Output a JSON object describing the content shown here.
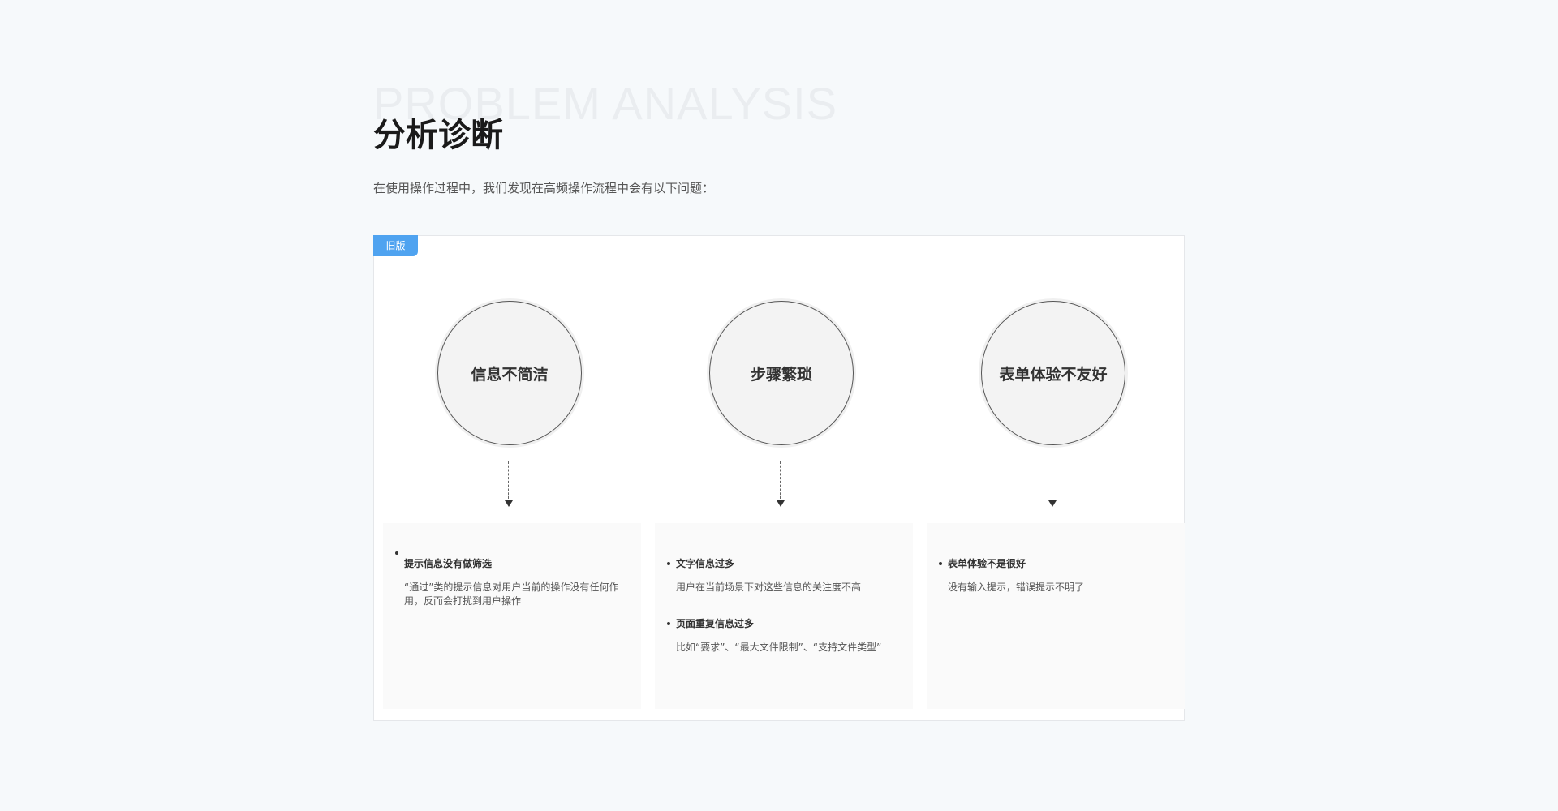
{
  "header": {
    "bg_title": "PROBLEM ANALYSIS",
    "title": "分析诊断",
    "subtitle": "在使用操作过程中，我们发现在高频操作流程中会有以下问题："
  },
  "panel": {
    "badge": "旧版",
    "badge_color": "#4fa3f0",
    "columns": [
      {
        "circle_label": "信息不简洁",
        "items": [
          {
            "title": "提示信息没有做筛选",
            "desc": "“通过”类的提示信息对用户当前的操作没有任何作用，反而会打扰到用户操作"
          }
        ]
      },
      {
        "circle_label": "步骤繁琐",
        "items": [
          {
            "title": "文字信息过多",
            "desc": "用户在当前场景下对这些信息的关注度不高"
          },
          {
            "title": "页面重复信息过多",
            "desc": "比如“要求”、“最大文件限制”、“支持文件类型”"
          }
        ]
      },
      {
        "circle_label": "表单体验不友好",
        "items": [
          {
            "title": "表单体验不是很好",
            "desc": "没有输入提示，错误提示不明了"
          }
        ]
      }
    ]
  }
}
